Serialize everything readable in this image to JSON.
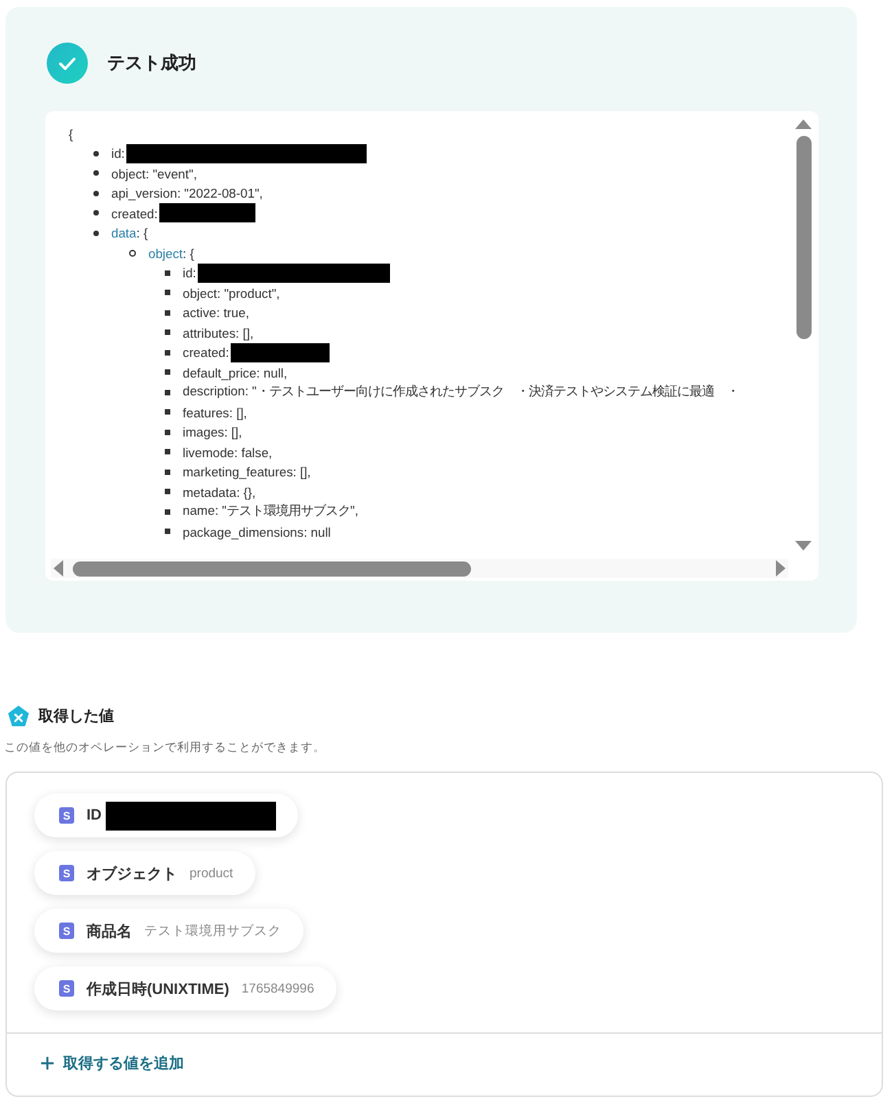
{
  "result": {
    "success": true,
    "title": "テスト成功"
  },
  "payload": {
    "open": "{",
    "items": [
      {
        "key": "id",
        "rest": ":",
        "redacted": true
      },
      {
        "key": "object",
        "rest": ": \"event\","
      },
      {
        "key": "api_version",
        "rest": ": \"2022-08-01\","
      },
      {
        "key": "created",
        "rest": ":",
        "redacted": true
      },
      {
        "key": "data",
        "rest": ": {",
        "kind": "object",
        "children": [
          {
            "key": "object",
            "rest": ": {",
            "kind": "object",
            "children": [
              {
                "key": "id",
                "rest": ":",
                "redacted": true
              },
              {
                "key": "object",
                "rest": ": \"product\","
              },
              {
                "key": "active",
                "rest": ": true,"
              },
              {
                "key": "attributes",
                "rest": ": [],"
              },
              {
                "key": "created",
                "rest": ":",
                "redacted": true
              },
              {
                "key": "default_price",
                "rest": ": null,"
              },
              {
                "key": "description",
                "rest": ": \"・テストユーザー向けに作成されたサブスク　・決済テストやシステム検証に最適　・"
              },
              {
                "key": "features",
                "rest": ": [],"
              },
              {
                "key": "images",
                "rest": ": [],"
              },
              {
                "key": "livemode",
                "rest": ": false,"
              },
              {
                "key": "marketing_features",
                "rest": ": [],"
              },
              {
                "key": "metadata",
                "rest": ": {},"
              },
              {
                "key": "name",
                "rest": ": \"テスト環境用サブスク\","
              },
              {
                "key": "package_dimensions",
                "rest": ": null"
              }
            ]
          }
        ]
      }
    ]
  },
  "values": {
    "title": "取得した値",
    "description": "この値を他のオペレーションで利用することができます。",
    "chips": [
      {
        "badge": "S",
        "label": "ID",
        "redacted": true
      },
      {
        "badge": "S",
        "label": "オブジェクト",
        "value": "product"
      },
      {
        "badge": "S",
        "label": "商品名",
        "value": "テスト環境用サブスク"
      },
      {
        "badge": "S",
        "label": "作成日時(UNIXTIME)",
        "value": "1765849996"
      }
    ],
    "add_label": "取得する値を追加"
  }
}
